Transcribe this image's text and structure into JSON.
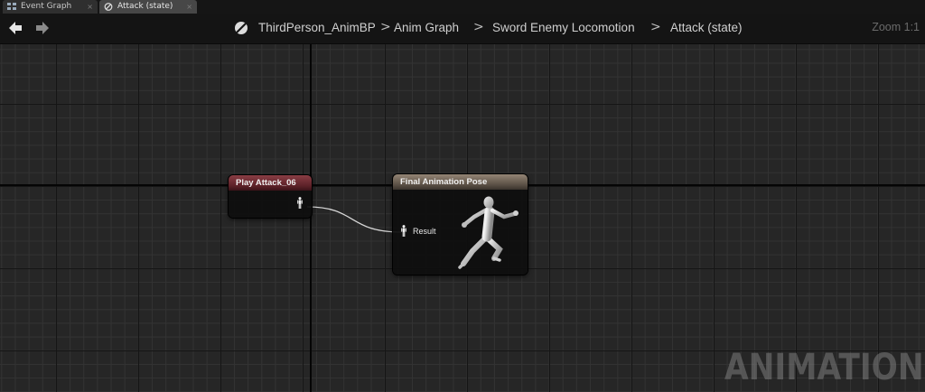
{
  "tabs": [
    {
      "label": "Event Graph",
      "close": "×",
      "icon": "graph-icon"
    },
    {
      "label": "Attack (state)",
      "close": "×",
      "icon": "state-icon"
    }
  ],
  "breadcrumb": {
    "icon": "blueprint-icon",
    "items": [
      "ThirdPerson_AnimBP",
      "Anim Graph",
      "Sword Enemy Locomotion",
      "Attack (state)"
    ],
    "separator": ">"
  },
  "zoom": "Zoom 1:1",
  "nodes": {
    "play": {
      "title": "Play Attack_06",
      "header_color": "#7a3038"
    },
    "final": {
      "title": "Final Animation Pose",
      "pin_label": "Result",
      "header_color": "#8a7c6c"
    }
  },
  "watermark": "ANIMATION"
}
